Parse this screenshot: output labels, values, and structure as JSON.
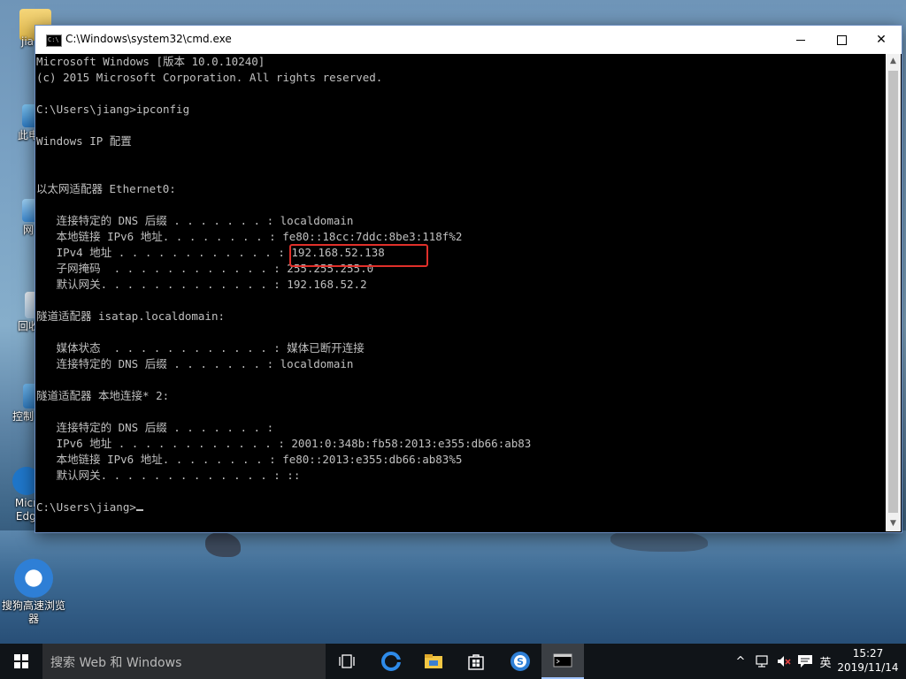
{
  "desktop": {
    "icons": [
      {
        "label": "jia"
      },
      {
        "label": "此电"
      },
      {
        "label": "网"
      },
      {
        "label": "回收"
      },
      {
        "label": "控制"
      },
      {
        "label": "Micro Edge"
      },
      {
        "label": "搜狗高速浏览器"
      }
    ]
  },
  "window": {
    "title": "C:\\Windows\\system32\\cmd.exe",
    "icon_text": "C:\\",
    "minimize_glyph": "—",
    "maximize_glyph": "☐",
    "close_glyph": "✕"
  },
  "console": {
    "lines": [
      "Microsoft Windows [版本 10.0.10240]",
      "(c) 2015 Microsoft Corporation. All rights reserved.",
      "",
      "C:\\Users\\jiang>ipconfig",
      "",
      "Windows IP 配置",
      "",
      "",
      "以太网适配器 Ethernet0:",
      "",
      "   连接特定的 DNS 后缀 . . . . . . . : localdomain",
      "   本地链接 IPv6 地址. . . . . . . . : fe80::18cc:7ddc:8be3:118f%2",
      "   IPv4 地址 . . . . . . . . . . . . : 192.168.52.138",
      "   子网掩码  . . . . . . . . . . . . : 255.255.255.0",
      "   默认网关. . . . . . . . . . . . . : 192.168.52.2",
      "",
      "隧道适配器 isatap.localdomain:",
      "",
      "   媒体状态  . . . . . . . . . . . . : 媒体已断开连接",
      "   连接特定的 DNS 后缀 . . . . . . . : localdomain",
      "",
      "隧道适配器 本地连接* 2:",
      "",
      "   连接特定的 DNS 后缀 . . . . . . . :",
      "   IPv6 地址 . . . . . . . . . . . . : 2001:0:348b:fb58:2013:e355:db66:ab83",
      "   本地链接 IPv6 地址. . . . . . . . : fe80::2013:e355:db66:ab83%5",
      "   默认网关. . . . . . . . . . . . . : ::",
      "",
      "C:\\Users\\jiang>"
    ]
  },
  "taskbar": {
    "search_placeholder": "搜索 Web 和 Windows",
    "apps": [
      "task-view",
      "edge",
      "file-explorer",
      "store",
      "sogou-browser",
      "cmd"
    ],
    "tray": {
      "chevron": "^",
      "ime": "英",
      "time": "15:27",
      "date": "2019/11/14"
    }
  },
  "colors": {
    "console_bg": "#000000",
    "console_text": "#c0c0c0",
    "highlight_box": "#e0302a",
    "taskbar_bg": "#101418"
  }
}
